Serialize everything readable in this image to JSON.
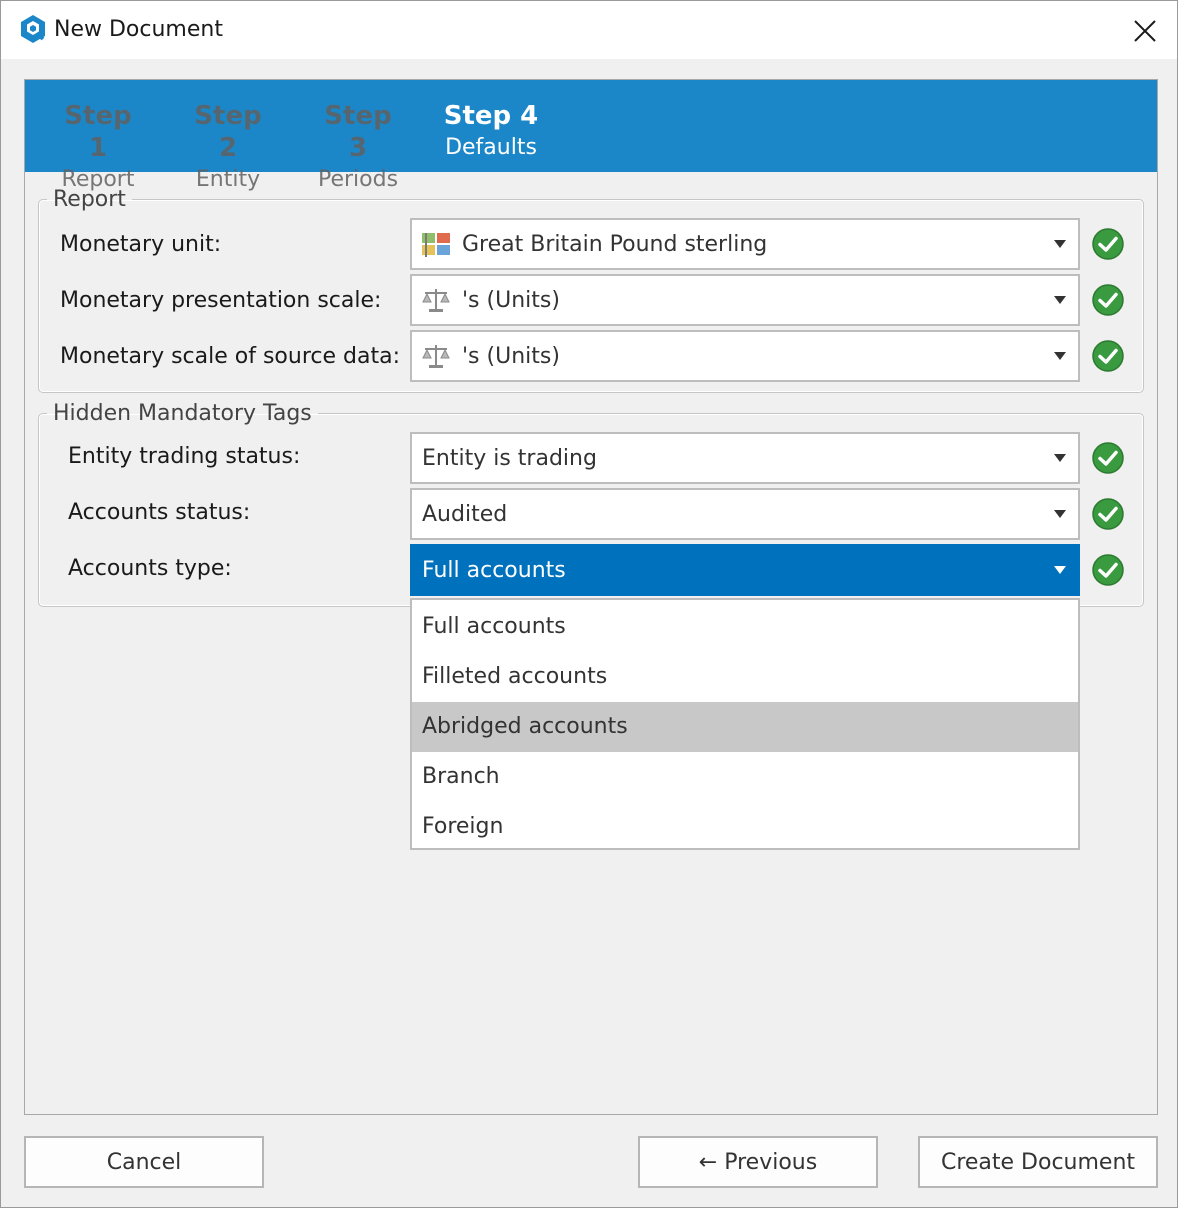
{
  "window": {
    "title": "New Document"
  },
  "steps": [
    {
      "num": "Step 1",
      "label": "Report",
      "state": "inactive"
    },
    {
      "num": "Step 2",
      "label": "Entity",
      "state": "inactive"
    },
    {
      "num": "Step 3",
      "label": "Periods",
      "state": "inactive"
    },
    {
      "num": "Step 4",
      "label": "Defaults",
      "state": "active"
    }
  ],
  "report": {
    "legend": "Report",
    "fields": [
      {
        "label": "Monetary unit:",
        "value": "Great Britain Pound sterling",
        "icon": "flag-icon",
        "valid": true
      },
      {
        "label": "Monetary presentation scale:",
        "value": "'s (Units)",
        "icon": "scale-icon",
        "valid": true
      },
      {
        "label": "Monetary scale of source data:",
        "value": "'s (Units)",
        "icon": "scale-icon",
        "valid": true
      }
    ]
  },
  "hidden_tags": {
    "legend": "Hidden Mandatory Tags",
    "fields": [
      {
        "label": "Entity trading status:",
        "value": "Entity is trading",
        "valid": true
      },
      {
        "label": "Accounts status:",
        "value": "Audited",
        "valid": true
      },
      {
        "label": "Accounts type:",
        "value": "Full accounts",
        "valid": true,
        "open": true
      }
    ]
  },
  "accounts_type_options": [
    "Full accounts",
    "Filleted accounts",
    "Abridged accounts",
    "Branch",
    "Foreign"
  ],
  "hovered_option": "Abridged accounts",
  "buttons": {
    "cancel": "Cancel",
    "previous": "← Previous",
    "create": "Create Document"
  },
  "colors": {
    "accent": "#1b87c9",
    "selected": "#0071bc",
    "valid": "#3a9a3f"
  }
}
